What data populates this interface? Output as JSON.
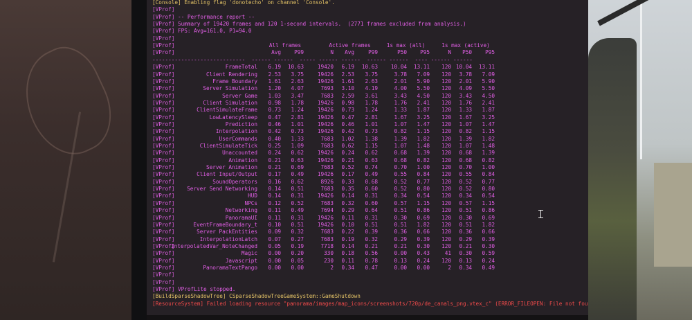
{
  "header_lines": [
    {
      "text": "[Console] Enabling flag 'donotecho' on channel 'Console'.",
      "style": "gold"
    },
    {
      "text": "[VProf]",
      "style": "dim"
    },
    {
      "text": "[VProf] -- Performance report --",
      "style": ""
    },
    {
      "text": "[VProf] Summary of 19420 frames and 120 1-second intervals.  (2771 frames excluded from analysis.)",
      "style": ""
    },
    {
      "text": "[VProf] FPS: Avg=161.0, P1=94.0",
      "style": ""
    },
    {
      "text": "[VProf]",
      "style": "dim"
    }
  ],
  "table_prefix": "[VProf]",
  "group_headers": [
    "All frames",
    "Active frames",
    "1s max (all)",
    "1s max (active)"
  ],
  "column_headers": [
    "Avg",
    "P99",
    "N",
    "Avg",
    "P99",
    "P50",
    "P95",
    "N",
    "P50",
    "P95"
  ],
  "separator": "-----------------------------  ------ ------  ----- ------ ------  ------ ------  ---- ------ ------",
  "rows": [
    {
      "name": "FrameTotal",
      "values": [
        "6.19",
        "10.63",
        "19420",
        "6.19",
        "10.63",
        "10.04",
        "13.11",
        "120",
        "10.04",
        "13.11"
      ]
    },
    {
      "name": "Client Rendering",
      "values": [
        "2.53",
        "3.75",
        "19426",
        "2.53",
        "3.75",
        "3.78",
        "7.09",
        "120",
        "3.78",
        "7.09"
      ]
    },
    {
      "name": "Frame Boundary",
      "values": [
        "1.61",
        "2.63",
        "19426",
        "1.61",
        "2.63",
        "2.01",
        "5.90",
        "120",
        "2.01",
        "5.90"
      ]
    },
    {
      "name": "Server Simulation",
      "values": [
        "1.20",
        "4.07",
        "7693",
        "3.10",
        "4.19",
        "4.00",
        "5.50",
        "120",
        "4.09",
        "5.50"
      ]
    },
    {
      "name": "Server Game",
      "values": [
        "1.03",
        "3.47",
        "7683",
        "2.59",
        "3.61",
        "3.43",
        "4.50",
        "120",
        "3.43",
        "4.50"
      ]
    },
    {
      "name": "Client Simulation",
      "values": [
        "0.98",
        "1.78",
        "19426",
        "0.98",
        "1.78",
        "1.76",
        "2.41",
        "120",
        "1.76",
        "2.41"
      ]
    },
    {
      "name": "ClientSimulateFrame",
      "values": [
        "0.73",
        "1.24",
        "19426",
        "0.73",
        "1.24",
        "1.33",
        "1.87",
        "120",
        "1.33",
        "1.87"
      ]
    },
    {
      "name": "LowLatencySleep",
      "values": [
        "0.47",
        "2.81",
        "19426",
        "0.47",
        "2.81",
        "1.67",
        "3.25",
        "120",
        "1.67",
        "3.25"
      ]
    },
    {
      "name": "Prediction",
      "values": [
        "0.46",
        "1.01",
        "19426",
        "0.46",
        "1.01",
        "1.07",
        "1.47",
        "120",
        "1.07",
        "1.47"
      ]
    },
    {
      "name": "Interpolation",
      "values": [
        "0.42",
        "0.73",
        "19426",
        "0.42",
        "0.73",
        "0.82",
        "1.15",
        "120",
        "0.82",
        "1.15"
      ]
    },
    {
      "name": "UserCommands",
      "values": [
        "0.40",
        "1.33",
        "7683",
        "1.02",
        "1.38",
        "1.39",
        "1.82",
        "120",
        "1.39",
        "1.82"
      ]
    },
    {
      "name": "ClientSimulateTick",
      "values": [
        "0.25",
        "1.09",
        "7683",
        "0.62",
        "1.15",
        "1.07",
        "1.48",
        "120",
        "1.07",
        "1.48"
      ]
    },
    {
      "name": "Unaccounted",
      "values": [
        "0.24",
        "0.62",
        "19426",
        "0.24",
        "0.62",
        "0.68",
        "1.39",
        "120",
        "0.68",
        "1.39"
      ]
    },
    {
      "name": "Animation",
      "values": [
        "0.21",
        "0.63",
        "19426",
        "0.21",
        "0.63",
        "0.68",
        "0.82",
        "120",
        "0.68",
        "0.82"
      ]
    },
    {
      "name": "Server Animation",
      "values": [
        "0.21",
        "0.69",
        "7683",
        "0.52",
        "0.74",
        "0.70",
        "1.00",
        "120",
        "0.70",
        "1.00"
      ]
    },
    {
      "name": "Client Input/Output",
      "values": [
        "0.17",
        "0.49",
        "19426",
        "0.17",
        "0.49",
        "0.55",
        "0.84",
        "120",
        "0.55",
        "0.84"
      ]
    },
    {
      "name": "SoundOperators",
      "values": [
        "0.16",
        "0.62",
        "8926",
        "0.33",
        "0.68",
        "0.52",
        "0.77",
        "120",
        "0.52",
        "0.77"
      ]
    },
    {
      "name": "Server Send Networking",
      "values": [
        "0.14",
        "0.51",
        "7683",
        "0.35",
        "0.60",
        "0.52",
        "0.80",
        "120",
        "0.52",
        "0.80"
      ]
    },
    {
      "name": "HUD",
      "values": [
        "0.14",
        "0.31",
        "19426",
        "0.14",
        "0.31",
        "0.34",
        "0.54",
        "120",
        "0.34",
        "0.54"
      ]
    },
    {
      "name": "NPCs",
      "values": [
        "0.12",
        "0.52",
        "7683",
        "0.32",
        "0.60",
        "0.57",
        "1.15",
        "120",
        "0.57",
        "1.15"
      ]
    },
    {
      "name": "Networking",
      "values": [
        "0.11",
        "0.49",
        "7694",
        "0.29",
        "0.64",
        "0.51",
        "0.86",
        "120",
        "0.51",
        "0.86"
      ]
    },
    {
      "name": "PanoramaUI",
      "values": [
        "0.11",
        "0.31",
        "19426",
        "0.11",
        "0.31",
        "0.30",
        "0.69",
        "120",
        "0.30",
        "0.69"
      ]
    },
    {
      "name": "EventFrameBoundary_t",
      "values": [
        "0.10",
        "0.51",
        "19426",
        "0.10",
        "0.51",
        "0.51",
        "1.82",
        "120",
        "0.51",
        "1.82"
      ]
    },
    {
      "name": "Server PackEntities",
      "values": [
        "0.09",
        "0.32",
        "7683",
        "0.22",
        "0.39",
        "0.36",
        "0.66",
        "120",
        "0.36",
        "0.66"
      ]
    },
    {
      "name": "InterpolationLatch",
      "values": [
        "0.07",
        "0.27",
        "7683",
        "0.19",
        "0.32",
        "0.29",
        "0.39",
        "120",
        "0.29",
        "0.39"
      ]
    },
    {
      "name": "InterpolatedVar_NoteChanged",
      "values": [
        "0.05",
        "0.19",
        "7718",
        "0.14",
        "0.21",
        "0.21",
        "0.30",
        "120",
        "0.21",
        "0.30"
      ]
    },
    {
      "name": "Magic",
      "values": [
        "0.00",
        "0.20",
        "330",
        "0.18",
        "0.56",
        "0.00",
        "0.43",
        "41",
        "0.30",
        "0.59"
      ]
    },
    {
      "name": "Javascript",
      "values": [
        "0.00",
        "0.05",
        "230",
        "0.11",
        "0.78",
        "0.13",
        "0.24",
        "120",
        "0.13",
        "0.24"
      ]
    },
    {
      "name": "PanoramaTextPango",
      "values": [
        "0.00",
        "0.00",
        "2",
        "0.34",
        "0.47",
        "0.00",
        "0.00",
        "2",
        "0.34",
        "0.49"
      ]
    }
  ],
  "footer_lines": [
    {
      "text": "[VProf]",
      "style": "dim"
    },
    {
      "text": "[VProf]",
      "style": "dim"
    },
    {
      "text": "[VProf] VProfLite stopped.",
      "style": ""
    },
    {
      "text": "[BuildSparseShadowTree] CSparseShadowTreeGameSystem::GameShutdown",
      "style": "gold"
    },
    {
      "text": "[ResourceSystem] Failed loading resource \"panorama/images/map_icons/screenshots/720p/de_canals_png.vtex_c\" (ERROR_FILEOPEN: File not found)",
      "style": "red"
    }
  ],
  "colors": {
    "console_text": "#e25fe6",
    "log_gold": "#e3c266",
    "error_red": "#ee4a4a",
    "console_bg": "#262126"
  }
}
